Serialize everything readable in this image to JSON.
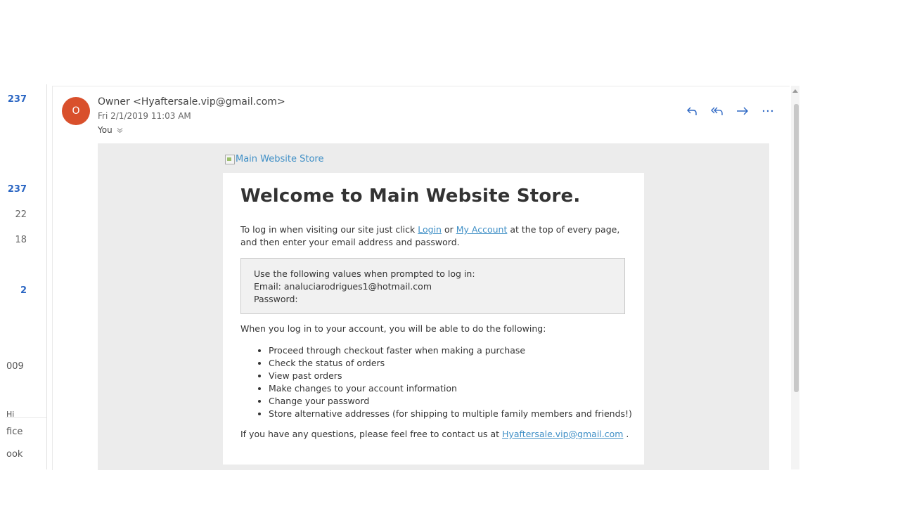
{
  "left_pane": {
    "counts": [
      "237",
      "237",
      "22",
      "18",
      "2"
    ],
    "fragments": [
      "009",
      "Hi",
      "fice",
      "ook"
    ]
  },
  "message": {
    "avatar_initial": "O",
    "sender": "Owner <Hyaftersale.vip@gmail.com>",
    "datetime": "Fri 2/1/2019 11:03 AM",
    "to": "You",
    "actions": [
      "reply-icon",
      "reply-all-icon",
      "forward-icon",
      "more-icon"
    ]
  },
  "email": {
    "logo_alt": "Main Website Store",
    "title": "Welcome to Main Website Store.",
    "intro_prefix": "To log in when visiting our site just click ",
    "login_link": "Login",
    "intro_or": " or ",
    "my_account_link": "My Account",
    "intro_suffix": " at the top of every page, and then enter your email address and password.",
    "creds_line1": "Use the following values when prompted to log in:",
    "creds_email": "Email: analuciarodrigues1@hotmail.com",
    "creds_password": "Password:",
    "following_text": "When you log in to your account, you will be able to do the following:",
    "benefits": [
      "Proceed through checkout faster when making a purchase",
      "Check the status of orders",
      "View past orders",
      "Make changes to your account information",
      "Change your password",
      "Store alternative addresses (for shipping to multiple family members and friends!)"
    ],
    "questions_prefix": "If you have any questions, please feel free to contact us at ",
    "contact_email": "Hyaftersale.vip@gmail.com",
    "questions_suffix": " ."
  },
  "colors": {
    "link": "#3f8fc6",
    "avatar": "#d9502c",
    "unread_count": "#2b66c3",
    "action_icons": "#2b66c3"
  }
}
